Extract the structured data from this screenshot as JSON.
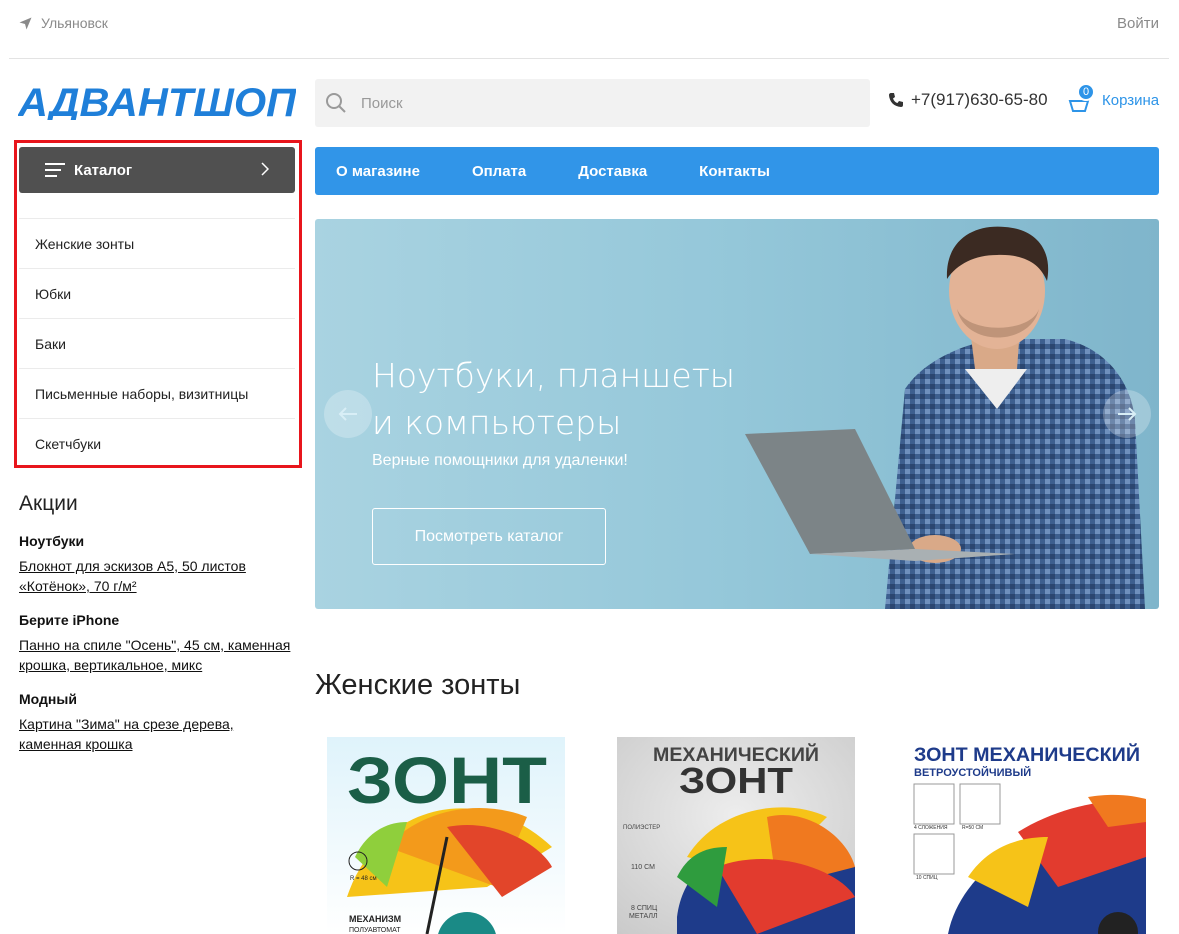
{
  "topbar": {
    "city": "Ульяновск",
    "login": "Войти"
  },
  "header": {
    "logo": "АДВАНТШОП",
    "search_placeholder": "Поиск",
    "phone": "+7(917)630-65-80",
    "cart_label": "Корзина",
    "cart_count": "0"
  },
  "catalog": {
    "button_label": "Каталог",
    "items": [
      {
        "label": "Женские зонты"
      },
      {
        "label": "Юбки"
      },
      {
        "label": "Баки"
      },
      {
        "label": "Письменные наборы, визитницы"
      },
      {
        "label": "Скетчбуки"
      }
    ]
  },
  "promotions": {
    "title": "Акции",
    "items": [
      {
        "name": "Ноутбуки",
        "link": "Блокнот для эскизов А5, 50 листов «Котёнок», 70 г/м²"
      },
      {
        "name": "Берите iPhone",
        "link": "Панно на спиле \"Осень\", 45 см, каменная крошка, вертикальное, микс"
      },
      {
        "name": "Модный",
        "link": "Картина \"Зима\" на срезе дерева, каменная крошка"
      }
    ]
  },
  "nav": {
    "items": [
      {
        "label": "О магазине"
      },
      {
        "label": "Оплата"
      },
      {
        "label": "Доставка"
      },
      {
        "label": "Контакты"
      }
    ]
  },
  "banner": {
    "title_line1": "Ноутбуки, планшеты",
    "title_line2": "и компьютеры",
    "subtitle": "Верные помощники для удаленки!",
    "button": "Посмотреть каталог"
  },
  "section": {
    "title": "Женские зонты"
  },
  "products": [
    {
      "headline": "ЗОНТ",
      "label1": "R = 48 см",
      "label2": "МЕХАНИЗМ",
      "label3": "ПОЛУАВТОМАТ"
    },
    {
      "headline1": "МЕХАНИЧЕСКИЙ",
      "headline2": "ЗОНТ",
      "label1": "ПОЛИЭСТЕР",
      "label2": "110 СМ",
      "label3": "8 СПИЦ",
      "label4": "МЕТАЛЛ"
    },
    {
      "headline1": "ЗОНТ МЕХАНИЧЕСКИЙ",
      "headline2": "ВЕТРОУСТОЙЧИВЫЙ",
      "label1": "4 СЛОЖЕНИЯ",
      "label2": "R=50 СМ",
      "label3": "10 СПИЦ"
    }
  ],
  "colors": {
    "accent": "#3195e8",
    "catalog_bg": "#505050",
    "highlight": "#e8151c"
  }
}
